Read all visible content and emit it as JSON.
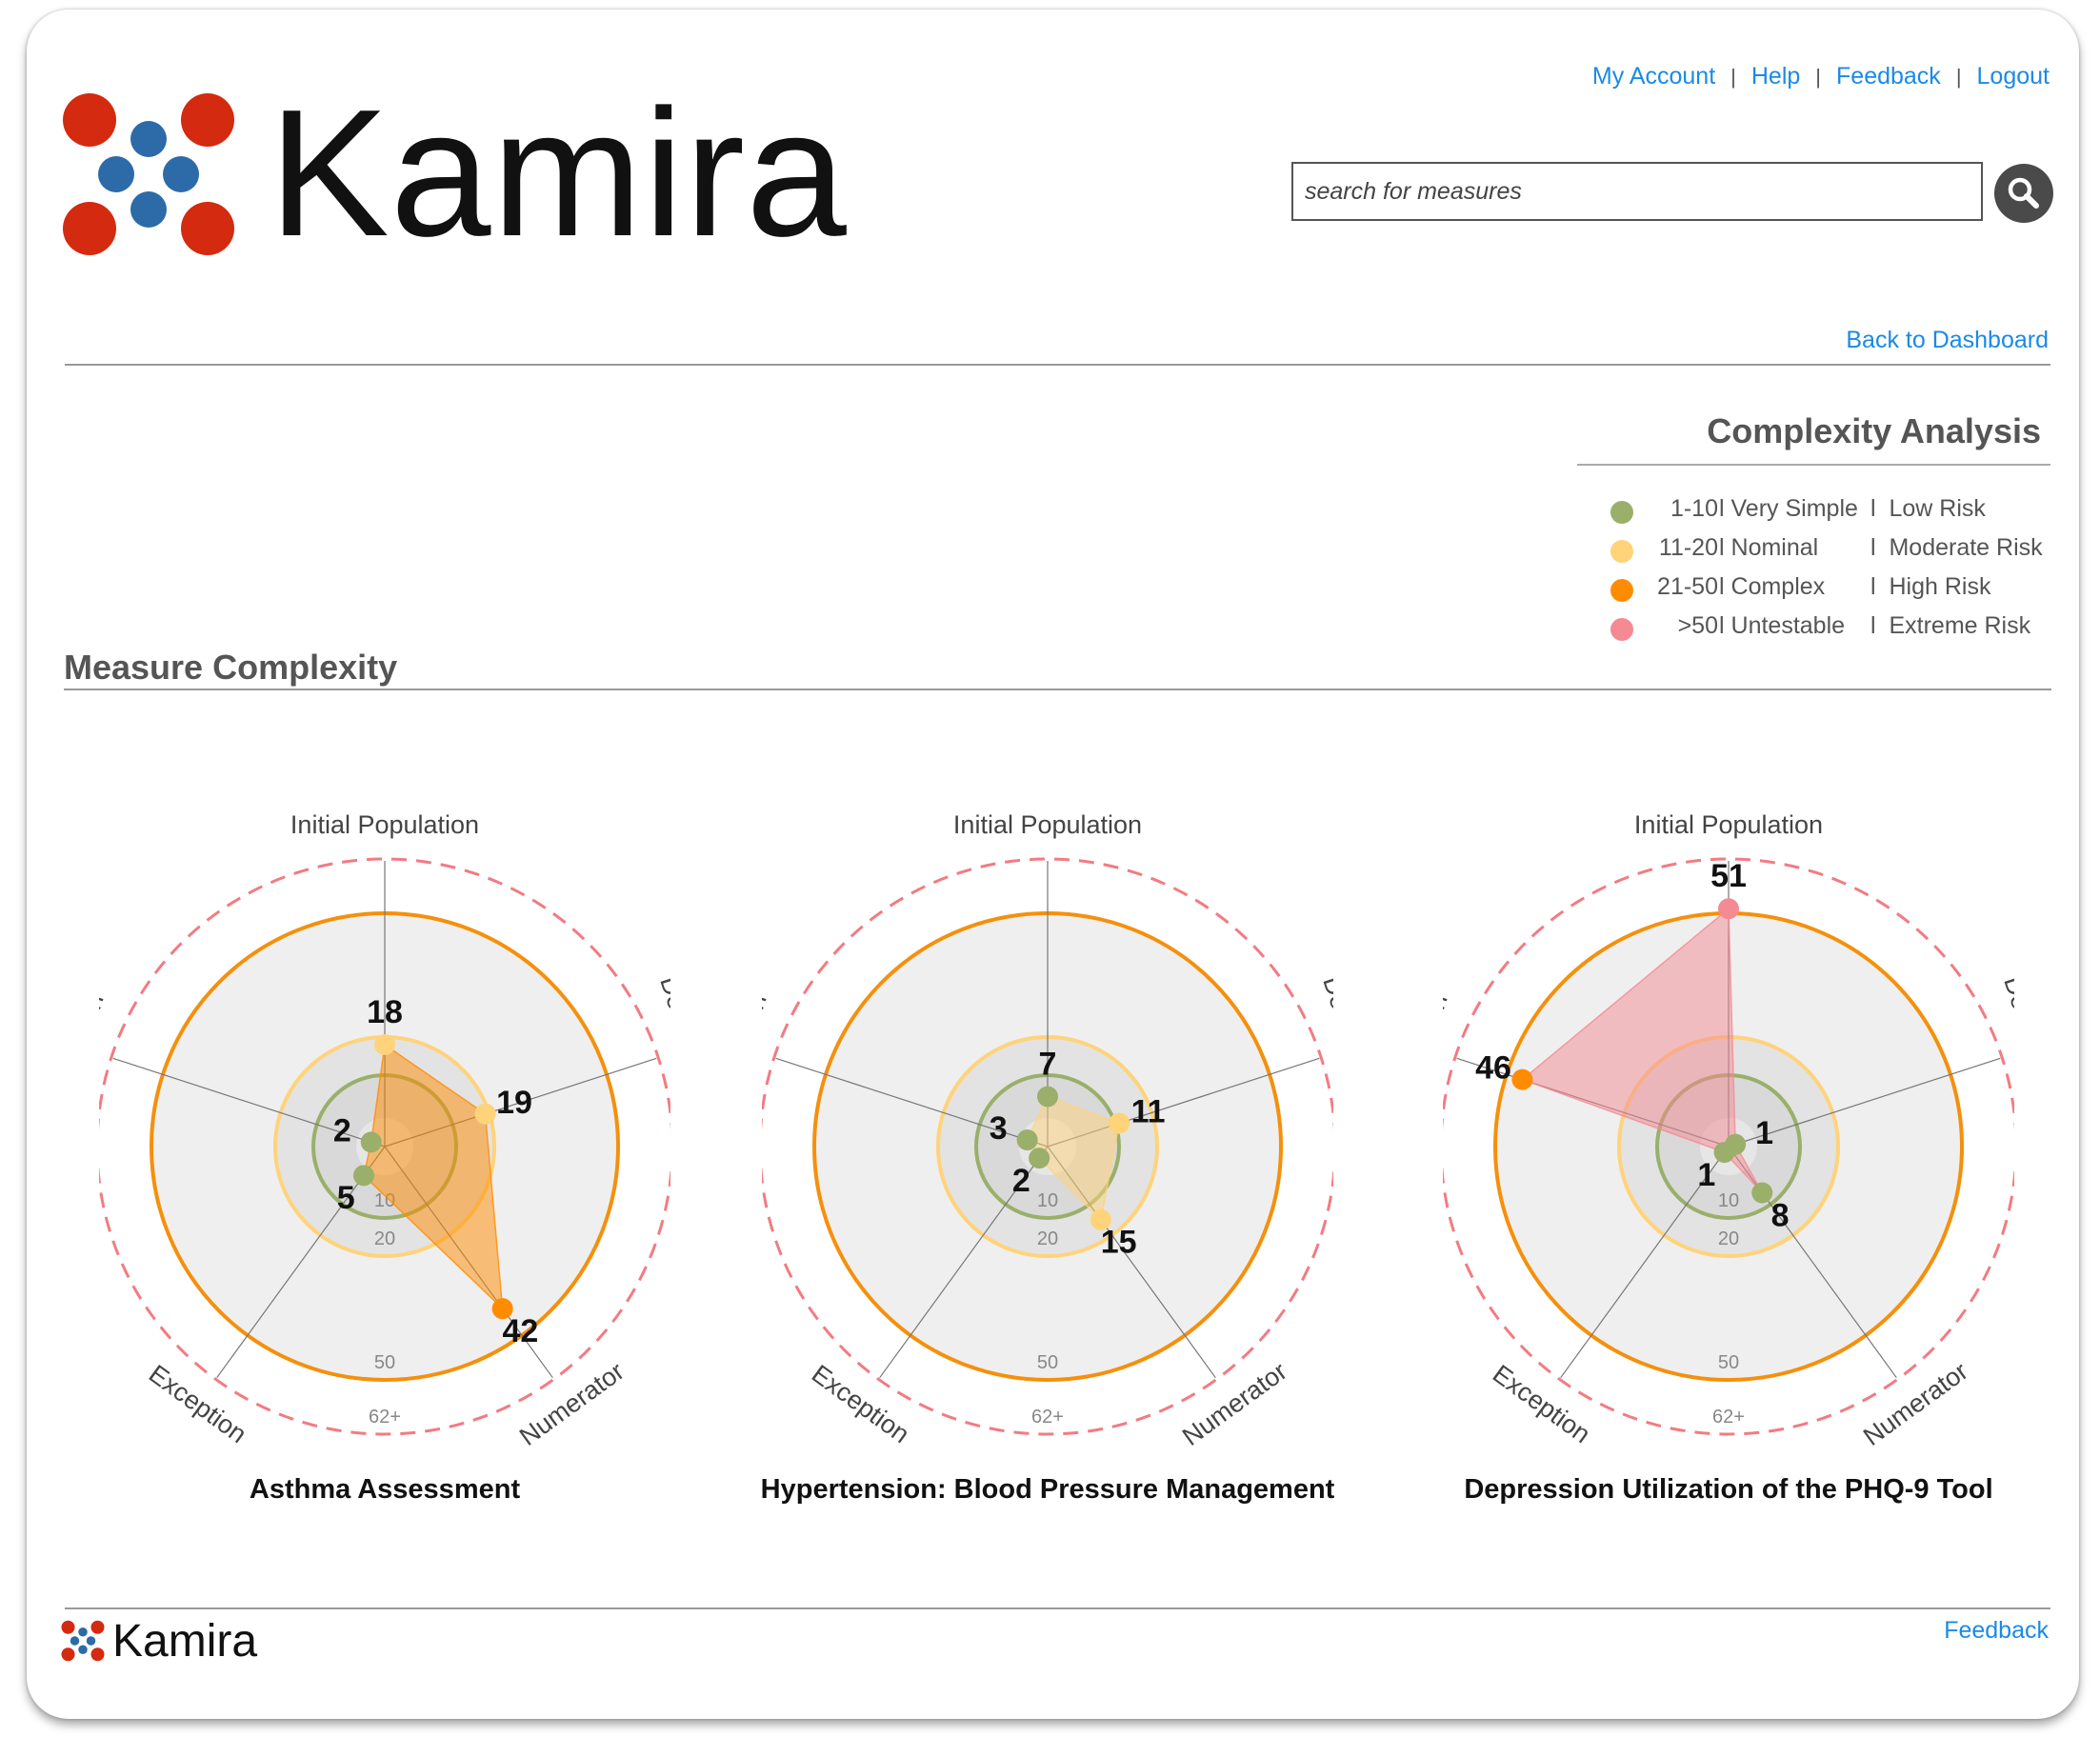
{
  "brand": {
    "name": "Kamira",
    "colors": {
      "red": "#d42a0f",
      "blue": "#2d6aa8"
    }
  },
  "nav": {
    "links": [
      "My Account",
      "Help",
      "Feedback",
      "Logout"
    ],
    "separator": "|"
  },
  "search": {
    "placeholder": "search for measures",
    "icon": "search-icon"
  },
  "back_link": "Back to Dashboard",
  "complexity_analysis": {
    "title": "Complexity Analysis",
    "legend": [
      {
        "range": "1-10",
        "level": "Very Simple",
        "risk": "Low Risk",
        "color": "#9aaf6a"
      },
      {
        "range": "11-20",
        "level": "Nominal",
        "risk": "Moderate Risk",
        "color": "#ffd37a"
      },
      {
        "range": "21-50",
        "level": "Complex",
        "risk": "High Risk",
        "color": "#ff8c00"
      },
      {
        "range": ">50",
        "level": "Untestable",
        "risk": "Extreme Risk",
        "color": "#f48a92"
      }
    ],
    "separator": "l"
  },
  "measure_complexity": {
    "title": "Measure Complexity"
  },
  "chart_data": [
    {
      "type": "radar",
      "title": "Asthma Assessment",
      "axes": [
        "Initial Population",
        "Denominator",
        "Numerator",
        "Exception",
        "Exclusion"
      ],
      "values": [
        18,
        19,
        42,
        5,
        2
      ],
      "ring_labels": [
        "10",
        "20",
        "50",
        "62+"
      ],
      "thresholds": [
        10,
        20,
        50,
        62
      ]
    },
    {
      "type": "radar",
      "title": "Hypertension: Blood Pressure Management",
      "axes": [
        "Initial Population",
        "Denominator",
        "Numerator",
        "Exception",
        "Exclusion"
      ],
      "values": [
        7,
        11,
        15,
        2,
        3
      ],
      "ring_labels": [
        "10",
        "20",
        "50",
        "62+"
      ],
      "thresholds": [
        10,
        20,
        50,
        62
      ]
    },
    {
      "type": "radar",
      "title": "Depression Utilization of the PHQ-9 Tool",
      "axes": [
        "Initial Population",
        "Denominator",
        "Numerator",
        "Exception",
        "Exclusion"
      ],
      "values": [
        51,
        1,
        8,
        1,
        46
      ],
      "ring_labels": [
        "10",
        "20",
        "50",
        "62+"
      ],
      "thresholds": [
        10,
        20,
        50,
        62
      ]
    }
  ],
  "footer": {
    "brand": "Kamira",
    "link": "Feedback"
  }
}
